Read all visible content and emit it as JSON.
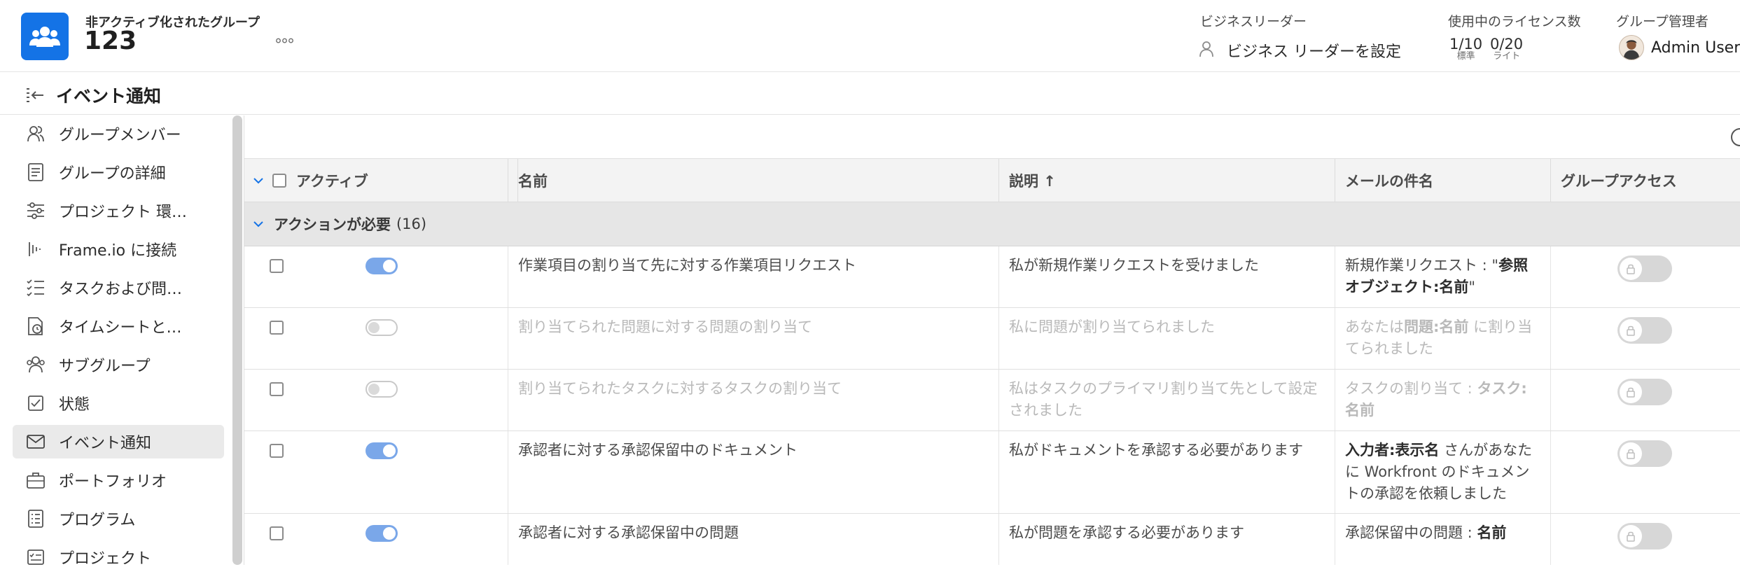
{
  "header": {
    "group_subtitle": "非アクティブ化されたグループ",
    "group_id": "123",
    "more_label": "°°°",
    "business_leader_label": "ビジネスリーダー",
    "business_leader_button": "ビジネス リーダーを設定",
    "licenses_label": "使用中のライセンス数",
    "license_standard_value": "1/10",
    "license_standard_sub": "標準",
    "license_light_value": "0/20",
    "license_light_sub": "ライト",
    "group_admin_label": "グループ管理者",
    "admin_name": "Admin User"
  },
  "subheader": {
    "title": "イベント通知"
  },
  "sidebar": {
    "items": [
      {
        "label": "グループメンバー",
        "icon": "users-icon"
      },
      {
        "label": "グループの詳細",
        "icon": "document-icon"
      },
      {
        "label": "プロジェクト 環…",
        "icon": "sliders-icon"
      },
      {
        "label": "Frame.io に接続",
        "icon": "frameio-icon"
      },
      {
        "label": "タスクおよび問…",
        "icon": "checklist-icon"
      },
      {
        "label": "タイムシートと…",
        "icon": "timesheet-icon"
      },
      {
        "label": "サブグループ",
        "icon": "subgroup-icon"
      },
      {
        "label": "状態",
        "icon": "status-icon"
      },
      {
        "label": "イベント通知",
        "icon": "mail-icon",
        "active": true
      },
      {
        "label": "ポートフォリオ",
        "icon": "briefcase-icon"
      },
      {
        "label": "プログラム",
        "icon": "program-icon"
      },
      {
        "label": "プロジェクト",
        "icon": "project-icon"
      }
    ]
  },
  "table": {
    "columns": {
      "active": "アクティブ",
      "name": "名前",
      "description": "説明 ↑",
      "email_subject": "メールの件名",
      "group_access": "グループアクセス"
    },
    "group_title": "アクションが必要",
    "group_count": "(16)",
    "rows": [
      {
        "active": true,
        "name": "作業項目の割り当て先に対する作業項目リクエスト",
        "description": "私が新規作業リクエストを受けました",
        "subject_pre": "新規作業リクエスト : \"",
        "subject_bold": "参照オブジェクト:名前",
        "subject_post": "\""
      },
      {
        "active": false,
        "name": "割り当てられた問題に対する問題の割り当て",
        "description": "私に問題が割り当てられました",
        "subject_pre": "あなたは",
        "subject_bold": "問題:名前",
        "subject_post": " に割り当てられました"
      },
      {
        "active": false,
        "name": "割り当てられたタスクに対するタスクの割り当て",
        "description": "私はタスクのプライマリ割り当て先として設定されました",
        "subject_pre": "タスクの割り当て : ",
        "subject_bold": "タスク:名前",
        "subject_post": ""
      },
      {
        "active": true,
        "name": "承認者に対する承認保留中のドキュメント",
        "description": "私がドキュメントを承認する必要があります",
        "subject_pre": "",
        "subject_bold": "入力者:表示名",
        "subject_post": " さんがあなたに Workfront のドキュメントの承認を依頼しました"
      },
      {
        "active": true,
        "name": "承認者に対する承認保留中の問題",
        "description": "私が問題を承認する必要があります",
        "subject_pre": "承認保留中の問題 : ",
        "subject_bold": "名前",
        "subject_post": ""
      }
    ]
  },
  "colors": {
    "brand": "#1473e6",
    "toggle_on": "#7aa7e9",
    "active_item_bg": "#eaeaea"
  }
}
